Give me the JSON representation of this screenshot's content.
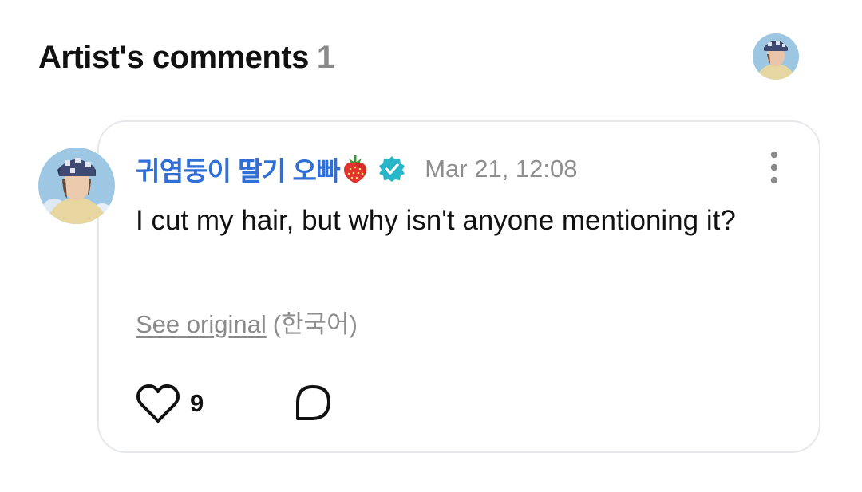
{
  "section": {
    "title": "Artist's comments",
    "count": "1"
  },
  "comment": {
    "author": "귀염둥이 딸기 오빠",
    "emoji_icon": "strawberry-icon",
    "verified_icon": "verified-badge-icon",
    "time": "Mar 21, 12:08",
    "text": "I cut my hair, but why isn't anyone mentioning it?",
    "see_original": "See original",
    "language": "(한국어)",
    "likes": "9"
  },
  "colors": {
    "author_name": "#2f6fd6",
    "verified_badge": "#27b7c9",
    "muted_text": "#8e8e8e",
    "card_border": "#e6e8ec"
  }
}
